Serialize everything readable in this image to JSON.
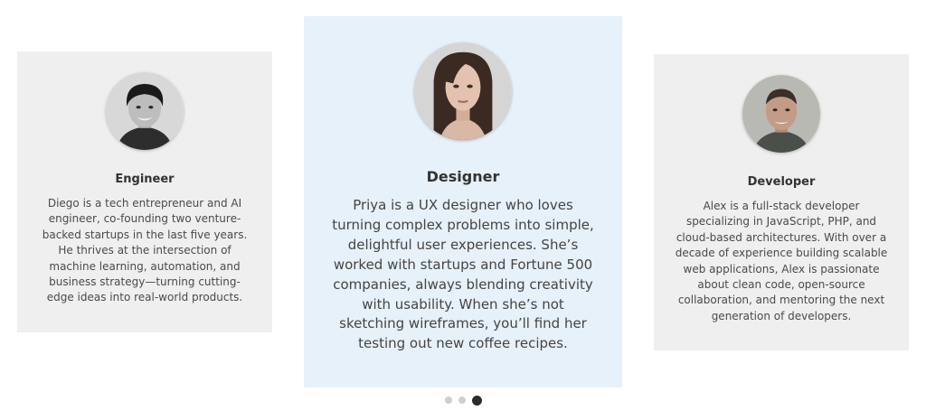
{
  "carousel": {
    "cards": [
      {
        "role": "Engineer",
        "bio": "Diego is a tech entrepreneur and AI engineer, co-founding two venture-backed startups in the last five years. He thrives at the intersection of machine learning, automation, and business strategy—turning cutting-edge ideas into real-world products.",
        "avatar_icon": "male-portrait-photo"
      },
      {
        "role": "Designer",
        "bio": "Priya is a UX designer who loves turning complex problems into simple, delightful user experiences. She’s worked with startups and Fortune 500 companies, always blending creativity with usability. When she’s not sketching wireframes, you’ll find her testing out new coffee recipes.",
        "avatar_icon": "female-portrait-photo"
      },
      {
        "role": "Developer",
        "bio": "Alex is a full-stack developer specializing in JavaScript, PHP, and cloud-based architectures. With over a decade of experience building scalable web applications, Alex is passionate about clean code, open-source collaboration, and mentoring the next generation of developers.",
        "avatar_icon": "male-portrait-photo"
      }
    ],
    "pagination": {
      "total": 3,
      "active_index": 2
    }
  },
  "colors": {
    "side_card_bg": "#efefef",
    "center_card_bg": "#e7f1f9",
    "dot_inactive": "#cfcfcf",
    "dot_active": "#2b2b2b"
  }
}
